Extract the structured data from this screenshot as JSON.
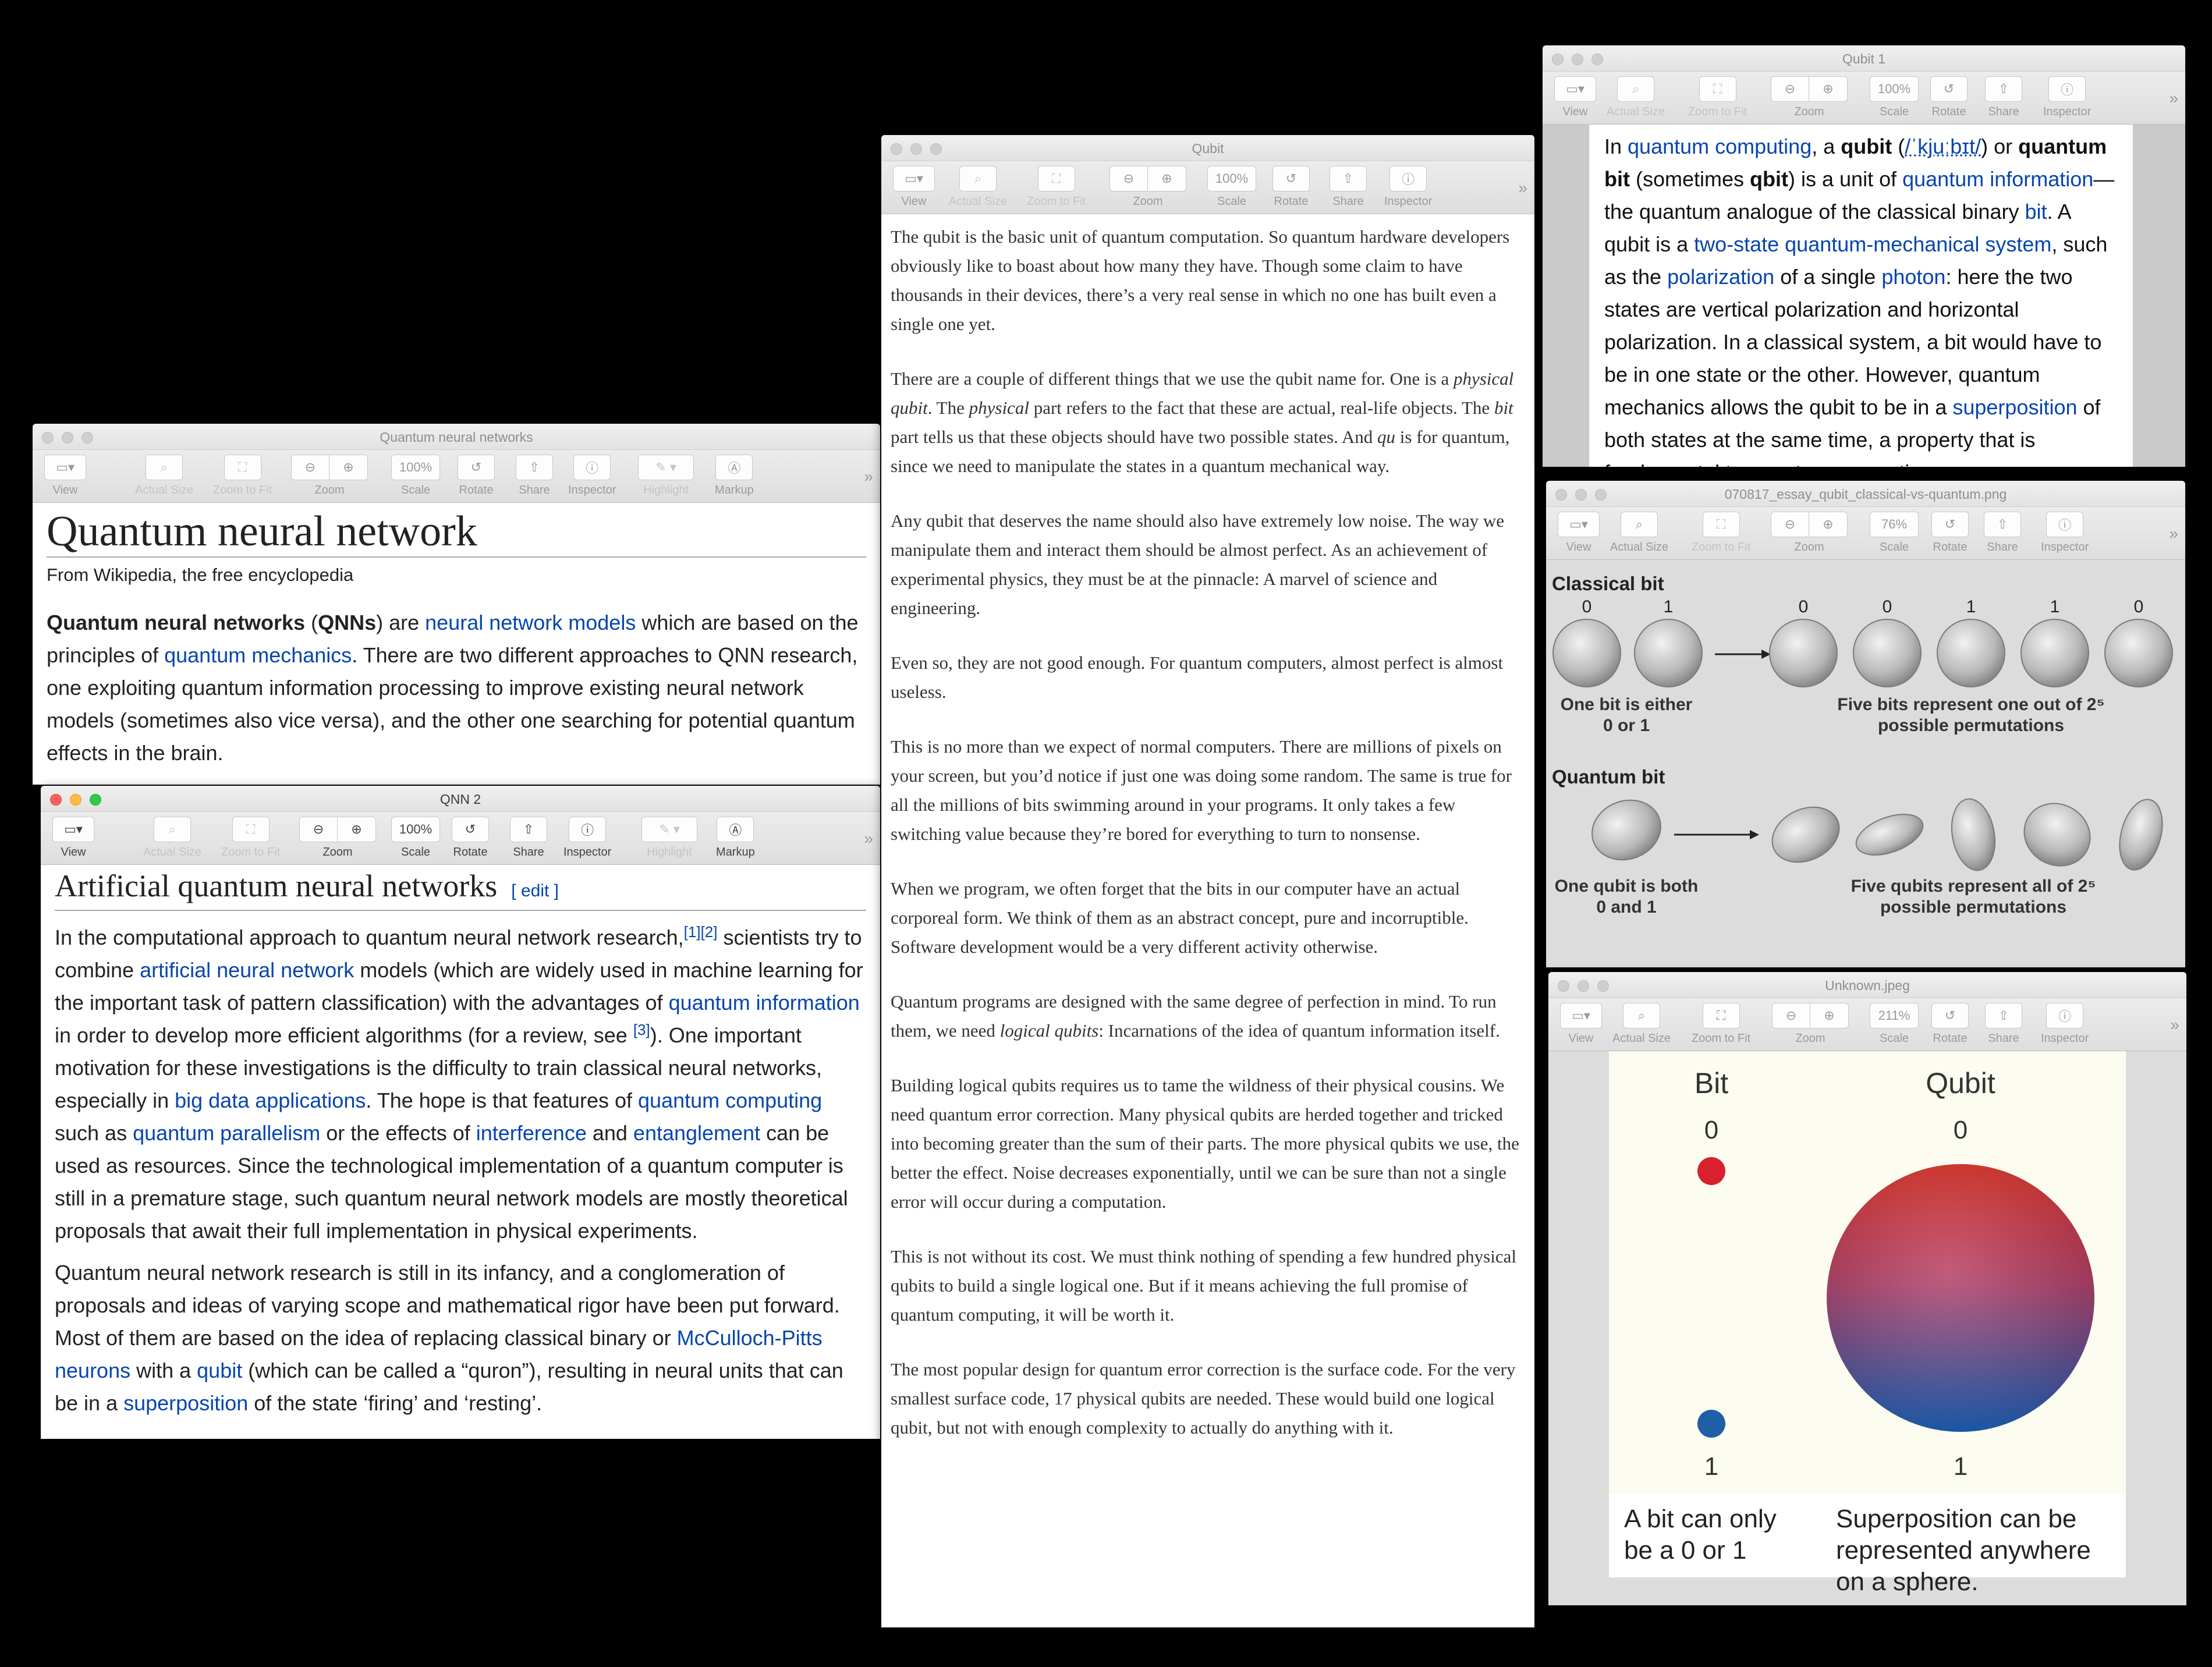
{
  "toolbar_labels": {
    "view": "View",
    "actual_size": "Actual Size",
    "zoom_to_fit": "Zoom to Fit",
    "zoom": "Zoom",
    "scale": "Scale",
    "rotate": "Rotate",
    "share": "Share",
    "inspector": "Inspector",
    "highlight": "Highlight",
    "markup": "Markup"
  },
  "win_qnn1": {
    "title": "Quantum neural networks",
    "scale": "100%",
    "heading": "Quantum neural network",
    "from": "From Wikipedia, the free encyclopedia",
    "p1": {
      "b1": "Quantum neural networks",
      "t1": " (",
      "b2": "QNNs",
      "t2": ") are ",
      "l1": "neural network models",
      "t3": " which are based on the principles of ",
      "l2": "quantum mechanics",
      "t4": ". There are two different approaches to QNN research, one exploiting quantum information processing to improve existing neural network models (sometimes also vice versa), and the other one searching for potential quantum effects in the brain."
    }
  },
  "win_qnn2": {
    "title": "QNN 2",
    "scale": "100%",
    "heading": "Artificial quantum neural networks",
    "edit": "[ edit ]",
    "p1": {
      "t1": "In the computational approach to quantum neural network research,",
      "s1": "[1][2]",
      "t2": " scientists try to combine ",
      "l1": "artificial neural network",
      "t3": " models (which are widely used in machine learning for the important task of pattern classification) with the advantages of ",
      "l2": "quantum information",
      "t4": " in order to develop more efficient algorithms (for a review, see ",
      "s2": "[3]",
      "t5": "). One important motivation for these investigations is the difficulty to train classical neural networks, especially in ",
      "l3": "big data applications",
      "t6": ". The hope is that features of ",
      "l4": "quantum computing",
      "t7": " such as ",
      "l5": "quantum parallelism",
      "t8": " or the effects of ",
      "l6": "interference",
      "t9": " and ",
      "l7": "entanglement",
      "t10": " can be used as resources. Since the technological implementation of a quantum computer is still in a premature stage, such quantum neural network models are mostly theoretical proposals that await their full implementation in physical experiments."
    },
    "p2": {
      "t1": "Quantum neural network research is still in its infancy, and a conglomeration of proposals and ideas of varying scope and mathematical rigor have been put forward. Most of them are based on the idea of replacing classical binary or ",
      "l1": "McCulloch-Pitts neurons",
      "t2": " with a ",
      "l2": "qubit",
      "t3": " (which can be called a “quron”), resulting in neural units that can be in a ",
      "l3": "superposition",
      "t4": " of the state ‘firing’ and ‘resting’."
    }
  },
  "win_qubit": {
    "title": "Qubit",
    "scale": "100%",
    "paragraphs": [
      "The qubit is the basic unit of quantum computation. So quantum hardware developers obviously like to boast about how many they have. Though some claim to have thousands in their devices, there’s a very real sense in which no one has built even a single one yet.",
      "",
      "Any qubit that deserves the name should also have extremely low noise. The way we manipulate them and interact them should be almost perfect. As an achievement of experimental physics, they must be at the pinnacle: A marvel of science and engineering.",
      "Even so, they are not good enough. For quantum computers, almost perfect is almost useless.",
      "This is no more than we expect of normal computers. There are millions of pixels on your screen, but you’d notice if just one was doing some random. The same is true for all the millions of bits swimming around in your programs. It only takes a few switching value because they’re bored for everything to turn to nonsense.",
      "When we program, we often forget that the bits in our computer have an actual corporeal form. We think of them as an abstract concept, pure and incorruptible. Software development would be a very different activity otherwise.",
      "",
      "Building logical qubits requires us to tame the wildness of their physical cousins. We need quantum error correction. Many physical qubits are herded together and tricked into becoming greater than the sum of their parts. The more physical qubits we use, the better the effect. Noise decreases exponentially, until we can be sure than not a single error will occur during a computation.",
      "This is not without its cost. We must think nothing of spending a few hundred physical qubits to build a single logical one. But if it means achieving the full promise of quantum computing, it will be worth it.",
      "The most popular design for quantum error correction is the surface code. For the very smallest surface code, 17 physical qubits are needed. These would build one logical qubit, but not with enough complexity to actually do anything with it."
    ],
    "p2": {
      "t1": "There are a couple of different things that we use the qubit name for. One is a ",
      "i1": "physical qubit",
      "t2": ". The ",
      "i2": "physical",
      "t3": " part refers to the fact that these are actual, real-life objects. The ",
      "i3": "bit",
      "t4": " part tells us that these objects should have two possible states. And ",
      "i4": "qu",
      "t5": " is for quantum, since we need to manipulate the states in a quantum mechanical way."
    },
    "p7": {
      "t1": "Quantum programs are designed with the same degree of perfection in mind. To run them, we need ",
      "i1": "logical qubits",
      "t2": ": Incarnations of the idea of quantum information itself."
    }
  },
  "win_qubit1": {
    "title": "Qubit 1",
    "scale": "100%",
    "p": {
      "t1": "In ",
      "l1": "quantum computing",
      "t2": ", a ",
      "b1": "qubit",
      "t3": " (",
      "l2": "/ˈkjuːbɪt/",
      "t4": ") or ",
      "b2": "quantum bit",
      "t5": " (sometimes ",
      "b3": "qbit",
      "t6": ") is a unit of ",
      "l3": "quantum information",
      "t7": "—the quantum analogue of the classical binary ",
      "l4": "bit",
      "t8": ". A qubit is a ",
      "l5": "two-state quantum-mechanical system",
      "t9": ", such as the ",
      "l6": "polarization",
      "t10": " of a single ",
      "l7": "photon",
      "t11": ": here the two states are vertical polarization and horizontal polarization.  In a classical system, a bit would have to be in one state or the other. However, quantum mechanics allows the qubit to be in a ",
      "l8": "superposition",
      "t12": " of both states at the same time, a property that is fundamental to quantum computing."
    }
  },
  "win_png": {
    "title": "070817_essay_qubit_classical-vs-quantum.png",
    "scale": "76%",
    "classical_label": "Classical bit",
    "classical_values": [
      "0",
      "1",
      "0",
      "0",
      "1",
      "1",
      "0"
    ],
    "caption1a": "One bit is either",
    "caption1b": "0 or 1",
    "caption2a": "Five bits represent one out of 2⁵",
    "caption2b": "possible permutations",
    "quantum_label": "Quantum bit",
    "caption3a": "One qubit is both",
    "caption3b": "0 and 1",
    "caption4a": "Five qubits represent all of 2⁵",
    "caption4b": "possible permutations"
  },
  "win_jpeg": {
    "title": "Unknown.jpeg",
    "scale": "211%",
    "bit_label": "Bit",
    "qubit_label": "Qubit",
    "zero": "0",
    "one": "1",
    "caption_left": "A bit can only be a 0 or 1",
    "caption_right": "Superposition can be represented anywhere on a sphere."
  },
  "colors": {
    "link": "#0645ad",
    "red_dot": "#d8202f",
    "blue_dot": "#1f5fa8"
  }
}
